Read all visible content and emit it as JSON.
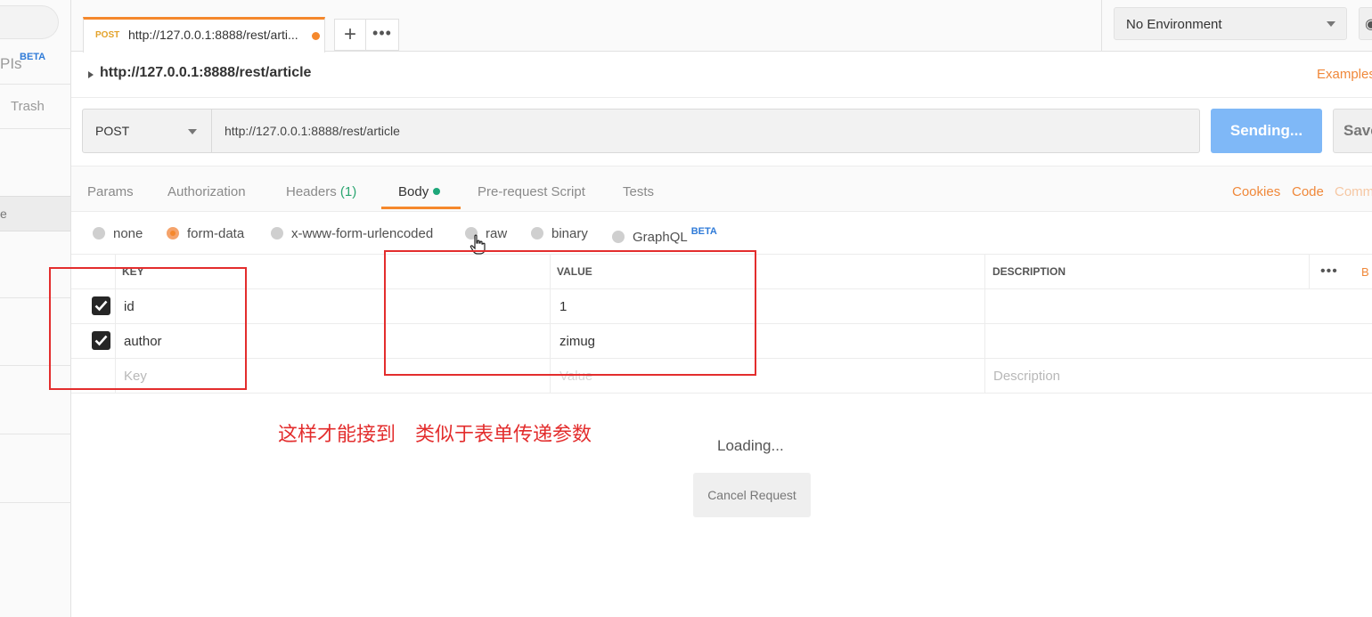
{
  "sidebar": {
    "apis_label": "PIs",
    "apis_beta": "BETA",
    "trash_label": "Trash",
    "selected_item_fragment": "e"
  },
  "tabs": {
    "active": {
      "method": "POST",
      "name": "http://127.0.0.1:8888/rest/arti...",
      "unsaved": true
    },
    "add_label": "+",
    "more_label": "•••"
  },
  "environment": {
    "selected": "No Environment"
  },
  "request": {
    "title": "http://127.0.0.1:8888/rest/article",
    "examples_label": "Examples",
    "method": "POST",
    "url": "http://127.0.0.1:8888/rest/article",
    "send_label": "Sending...",
    "save_label": "Save"
  },
  "subtabs": {
    "items": [
      "Params",
      "Authorization",
      "Headers",
      "Body",
      "Pre-request Script",
      "Tests"
    ],
    "headers_count": "(1)",
    "active": "Body",
    "right_links": [
      "Cookies",
      "Code",
      "Comm"
    ]
  },
  "body_types": {
    "options": [
      "none",
      "form-data",
      "x-www-form-urlencoded",
      "raw",
      "binary",
      "GraphQL"
    ],
    "selected": "form-data",
    "graphql_badge": "BETA"
  },
  "table": {
    "headers": [
      "KEY",
      "VALUE",
      "DESCRIPTION"
    ],
    "bulk_label": "B",
    "more_label": "•••",
    "rows": [
      {
        "checked": true,
        "key": "id",
        "value": "1",
        "description": ""
      },
      {
        "checked": true,
        "key": "author",
        "value": "zimug",
        "description": ""
      }
    ],
    "placeholder": {
      "key": "Key",
      "value": "Value",
      "description": "Description"
    }
  },
  "annotation": {
    "text": "这样才能接到　类似于表单传递参数",
    "color": "#e32d2d"
  },
  "response": {
    "loading": "Loading...",
    "cancel_label": "Cancel Request"
  },
  "colors": {
    "accent": "#f5882c",
    "send_button": "#7fb8f7",
    "beta_blue": "#2f7bd8",
    "count_green": "#2aa570"
  }
}
